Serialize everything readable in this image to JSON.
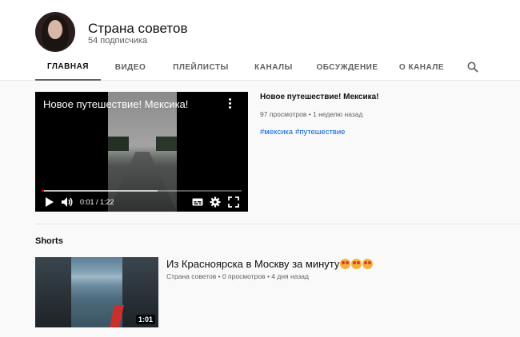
{
  "channel": {
    "name": "Страна советов",
    "subscribers": "54 подписчика"
  },
  "tabs": [
    {
      "label": "ГЛАВНАЯ",
      "active": true
    },
    {
      "label": "ВИДЕО",
      "active": false
    },
    {
      "label": "ПЛЕЙЛИСТЫ",
      "active": false
    },
    {
      "label": "КАНАЛЫ",
      "active": false
    },
    {
      "label": "ОБСУЖДЕНИЕ",
      "active": false
    },
    {
      "label": "О КАНАЛЕ",
      "active": false
    }
  ],
  "featured_video": {
    "player_title": "Новое путешествие! Мексика!",
    "time": "0:01 / 1:22",
    "progress_fraction": 0.012,
    "loaded_fraction": 0.58,
    "title": "Новое путешествие! Мексика!",
    "stats": "97 просмотров • 1 неделю назад",
    "tags": [
      "#мексика",
      "#путешествие"
    ]
  },
  "shorts": {
    "section_label": "Shorts",
    "items": [
      {
        "title": "Из Красноярска в Москву за минуту",
        "meta": "Страна советов • 0 просмотров • 4 дня назад",
        "duration": "1:01",
        "emoji_count": 3
      }
    ]
  },
  "colors": {
    "accent_red": "#ff0000",
    "link_blue": "#065fd4",
    "text_secondary": "#606060"
  }
}
